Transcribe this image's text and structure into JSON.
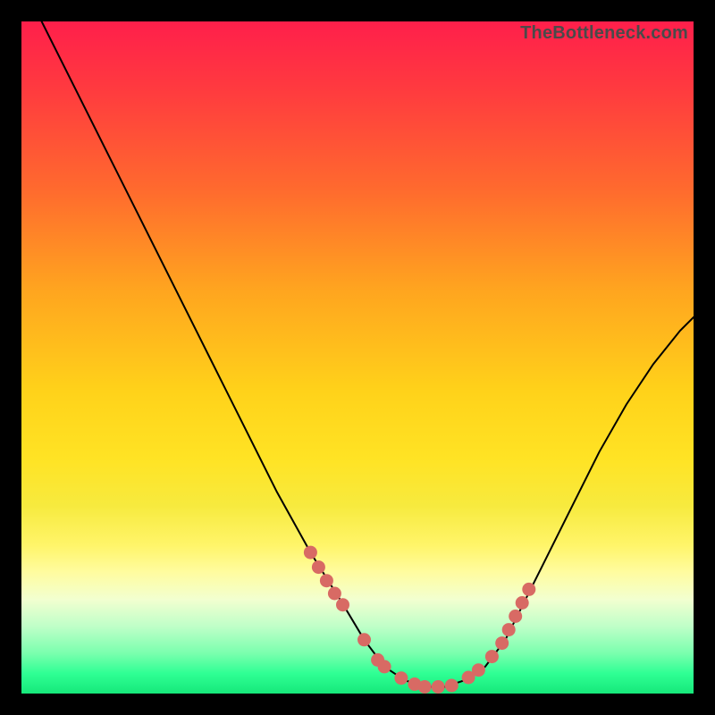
{
  "watermark": "TheBottleneck.com",
  "colors": {
    "dot": "#d86a64",
    "curve": "#000000",
    "frame": "#000000"
  },
  "chart_data": {
    "type": "line",
    "title": "",
    "xlabel": "",
    "ylabel": "",
    "xlim": [
      0,
      100
    ],
    "ylim": [
      0,
      100
    ],
    "grid": false,
    "legend": false,
    "series": [
      {
        "name": "bottleneck-curve",
        "x": [
          3,
          8,
          13,
          18,
          23,
          28,
          33,
          38,
          43,
          48,
          51,
          54,
          57,
          60,
          63,
          66,
          69,
          72,
          75,
          78,
          82,
          86,
          90,
          94,
          98,
          100
        ],
        "y": [
          100,
          90,
          80,
          70,
          60,
          50,
          40,
          30,
          21,
          13,
          8,
          4,
          2,
          1,
          1,
          2,
          4,
          8,
          14,
          20,
          28,
          36,
          43,
          49,
          54,
          56
        ]
      }
    ],
    "dots": {
      "name": "highlight-dots",
      "x": [
        43.0,
        44.2,
        45.4,
        46.6,
        47.8,
        51.0,
        53.0,
        54.0,
        56.5,
        58.5,
        60.0,
        62.0,
        64.0,
        66.5,
        68.0,
        70.0,
        71.5,
        72.5,
        73.5,
        74.5,
        75.5
      ],
      "y": [
        21.0,
        18.8,
        16.8,
        14.9,
        13.2,
        8.0,
        5.0,
        4.0,
        2.3,
        1.4,
        1.0,
        1.0,
        1.2,
        2.4,
        3.5,
        5.5,
        7.5,
        9.5,
        11.5,
        13.5,
        15.5
      ]
    }
  }
}
